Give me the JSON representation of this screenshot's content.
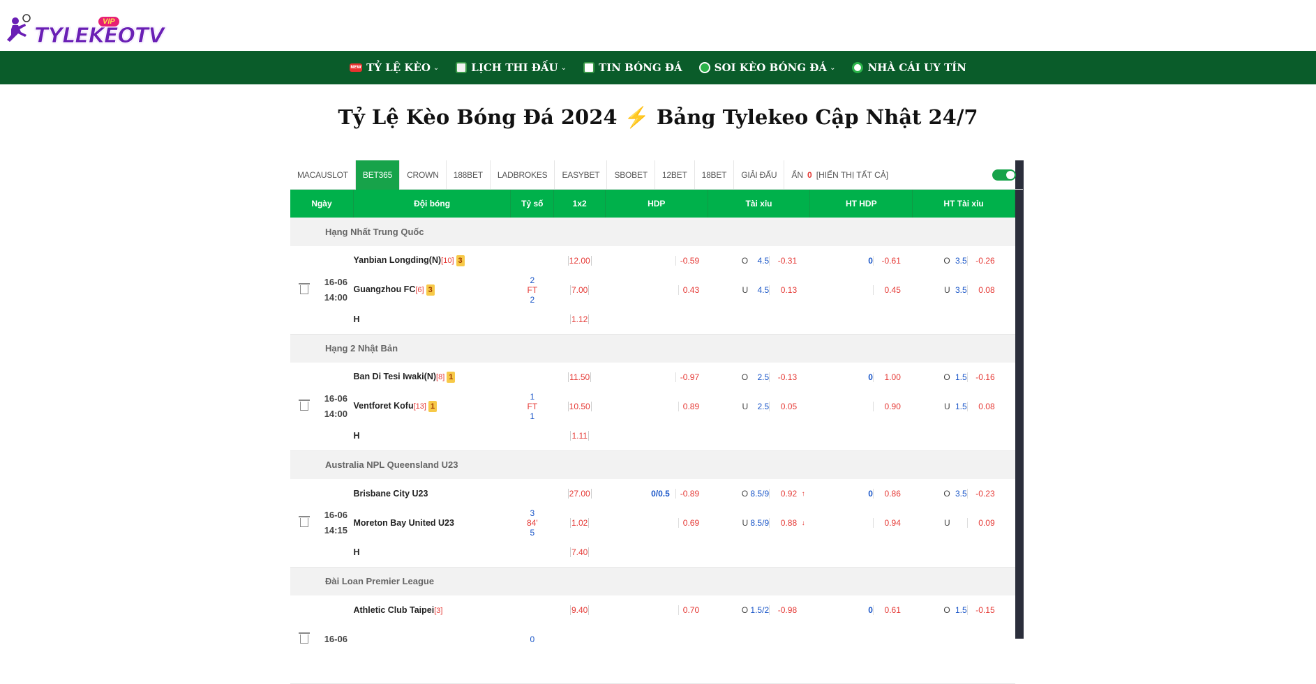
{
  "logo": {
    "text": "TYLEKEOTV",
    "vip": "VIP"
  },
  "nav": [
    {
      "label": "TỶ LỆ KÈO",
      "icon": "new-badge-icon",
      "dropdown": true
    },
    {
      "label": "LỊCH THI ĐẤU",
      "icon": "calendar-icon",
      "dropdown": true
    },
    {
      "label": "TIN BÓNG ĐÁ",
      "icon": "news-icon",
      "dropdown": false
    },
    {
      "label": "SOI KÈO BÓNG ĐÁ",
      "icon": "search-icon",
      "dropdown": true
    },
    {
      "label": "NHÀ CÁI UY TÍN",
      "icon": "ball-icon",
      "dropdown": false
    }
  ],
  "page_title": "Tỷ Lệ Kèo Bóng Đá 2024",
  "page_title_icon": "⚡",
  "page_title_rest": "Bảng Tylekeo Cập Nhật 24/7",
  "tabs": [
    "MACAUSLOT",
    "BET365",
    "CROWN",
    "188BET",
    "LADBROKES",
    "EASYBET",
    "SBOBET",
    "12BET",
    "18BET",
    "GIẢI ĐẤU"
  ],
  "active_tab": "BET365",
  "hide": {
    "label": "ẨN",
    "count": "0",
    "show_all": "[HIỂN THỊ TẤT CẢ]"
  },
  "columns": [
    "Ngày",
    "Đội bóng",
    "Tỷ số",
    "1x2",
    "HDP",
    "Tài xỉu",
    "HT HDP",
    "HT Tài xỉu"
  ],
  "matches": [
    {
      "league": "Hạng Nhất Trung Quốc",
      "date": "16-06",
      "time": "14:00",
      "home": {
        "name": "Yanbian Longding(N)",
        "rank": "[10]",
        "card": "3"
      },
      "away": {
        "name": "Guangzhou FC",
        "rank": "[6]",
        "card": "3"
      },
      "score": {
        "home": "2",
        "status": "FT",
        "away": "2"
      },
      "draw_label": "H",
      "x12": [
        "12.00",
        "7.00",
        "1.12"
      ],
      "hdp": {
        "line": "",
        "home": "-0.59",
        "away": "0.43"
      },
      "ou": {
        "o_label": "O",
        "o_line": "4.5",
        "o_odds": "-0.31",
        "u_label": "U",
        "u_line": "4.5",
        "u_odds": "0.13"
      },
      "ht_hdp": {
        "line": "0",
        "home": "-0.61",
        "away": "0.45"
      },
      "ht_ou": {
        "o_label": "O",
        "o_line": "3.5",
        "o_odds": "-0.26",
        "u_label": "U",
        "u_line": "3.5",
        "u_odds": "0.08"
      }
    },
    {
      "league": "Hạng 2 Nhật Bản",
      "date": "16-06",
      "time": "14:00",
      "home": {
        "name": "Ban Di Tesi Iwaki(N)",
        "rank": "[8]",
        "card": "1"
      },
      "away": {
        "name": "Ventforet Kofu",
        "rank": "[13]",
        "card": "1"
      },
      "score": {
        "home": "1",
        "status": "FT",
        "away": "1"
      },
      "draw_label": "H",
      "x12": [
        "11.50",
        "10.50",
        "1.11"
      ],
      "hdp": {
        "line": "",
        "home": "-0.97",
        "away": "0.89"
      },
      "ou": {
        "o_label": "O",
        "o_line": "2.5",
        "o_odds": "-0.13",
        "u_label": "U",
        "u_line": "2.5",
        "u_odds": "0.05"
      },
      "ht_hdp": {
        "line": "0",
        "home": "1.00",
        "away": "0.90"
      },
      "ht_ou": {
        "o_label": "O",
        "o_line": "1.5",
        "o_odds": "-0.16",
        "u_label": "U",
        "u_line": "1.5",
        "u_odds": "0.08"
      }
    },
    {
      "league": "Australia NPL Queensland U23",
      "date": "16-06",
      "time": "14:15",
      "home": {
        "name": "Brisbane City U23",
        "rank": "",
        "card": ""
      },
      "away": {
        "name": "Moreton Bay United U23",
        "rank": "",
        "card": ""
      },
      "score": {
        "home": "3",
        "status": "84'",
        "away": "5"
      },
      "draw_label": "H",
      "x12": [
        "27.00",
        "1.02",
        "7.40"
      ],
      "hdp": {
        "line": "0/0.5",
        "home": "-0.89",
        "away": "0.69"
      },
      "ou": {
        "o_label": "O",
        "o_line": "8.5/9",
        "o_odds": "0.92",
        "u_label": "U",
        "u_line": "8.5/9",
        "u_odds": "0.88",
        "o_arrow": "↑",
        "u_arrow": "↓"
      },
      "ht_hdp": {
        "line": "0",
        "home": "0.86",
        "away": "0.94"
      },
      "ht_ou": {
        "o_label": "O",
        "o_line": "3.5",
        "o_odds": "-0.23",
        "u_label": "U",
        "u_line": "",
        "u_odds": "0.09"
      }
    },
    {
      "league": "Đài Loan Premier League",
      "date": "16-06",
      "time": "",
      "home": {
        "name": "Athletic Club Taipei",
        "rank": "[3]",
        "card": ""
      },
      "away": {
        "name": "",
        "rank": "",
        "card": ""
      },
      "score": {
        "home": "0",
        "status": "",
        "away": ""
      },
      "draw_label": "",
      "x12": [
        "9.40",
        "",
        ""
      ],
      "hdp": {
        "line": "",
        "home": "0.70",
        "away": ""
      },
      "ou": {
        "o_label": "O",
        "o_line": "1.5/2",
        "o_odds": "-0.98",
        "u_label": "",
        "u_line": "",
        "u_odds": ""
      },
      "ht_hdp": {
        "line": "0",
        "home": "0.61",
        "away": ""
      },
      "ht_ou": {
        "o_label": "O",
        "o_line": "1.5",
        "o_odds": "-0.15",
        "u_label": "",
        "u_line": "",
        "u_odds": ""
      }
    }
  ],
  "colors": {
    "nav_bg": "#0a5c2a",
    "header_green": "#00b14b",
    "active_tab": "#17a34a",
    "odds_red": "#e53935",
    "odds_blue": "#1a56c8"
  }
}
